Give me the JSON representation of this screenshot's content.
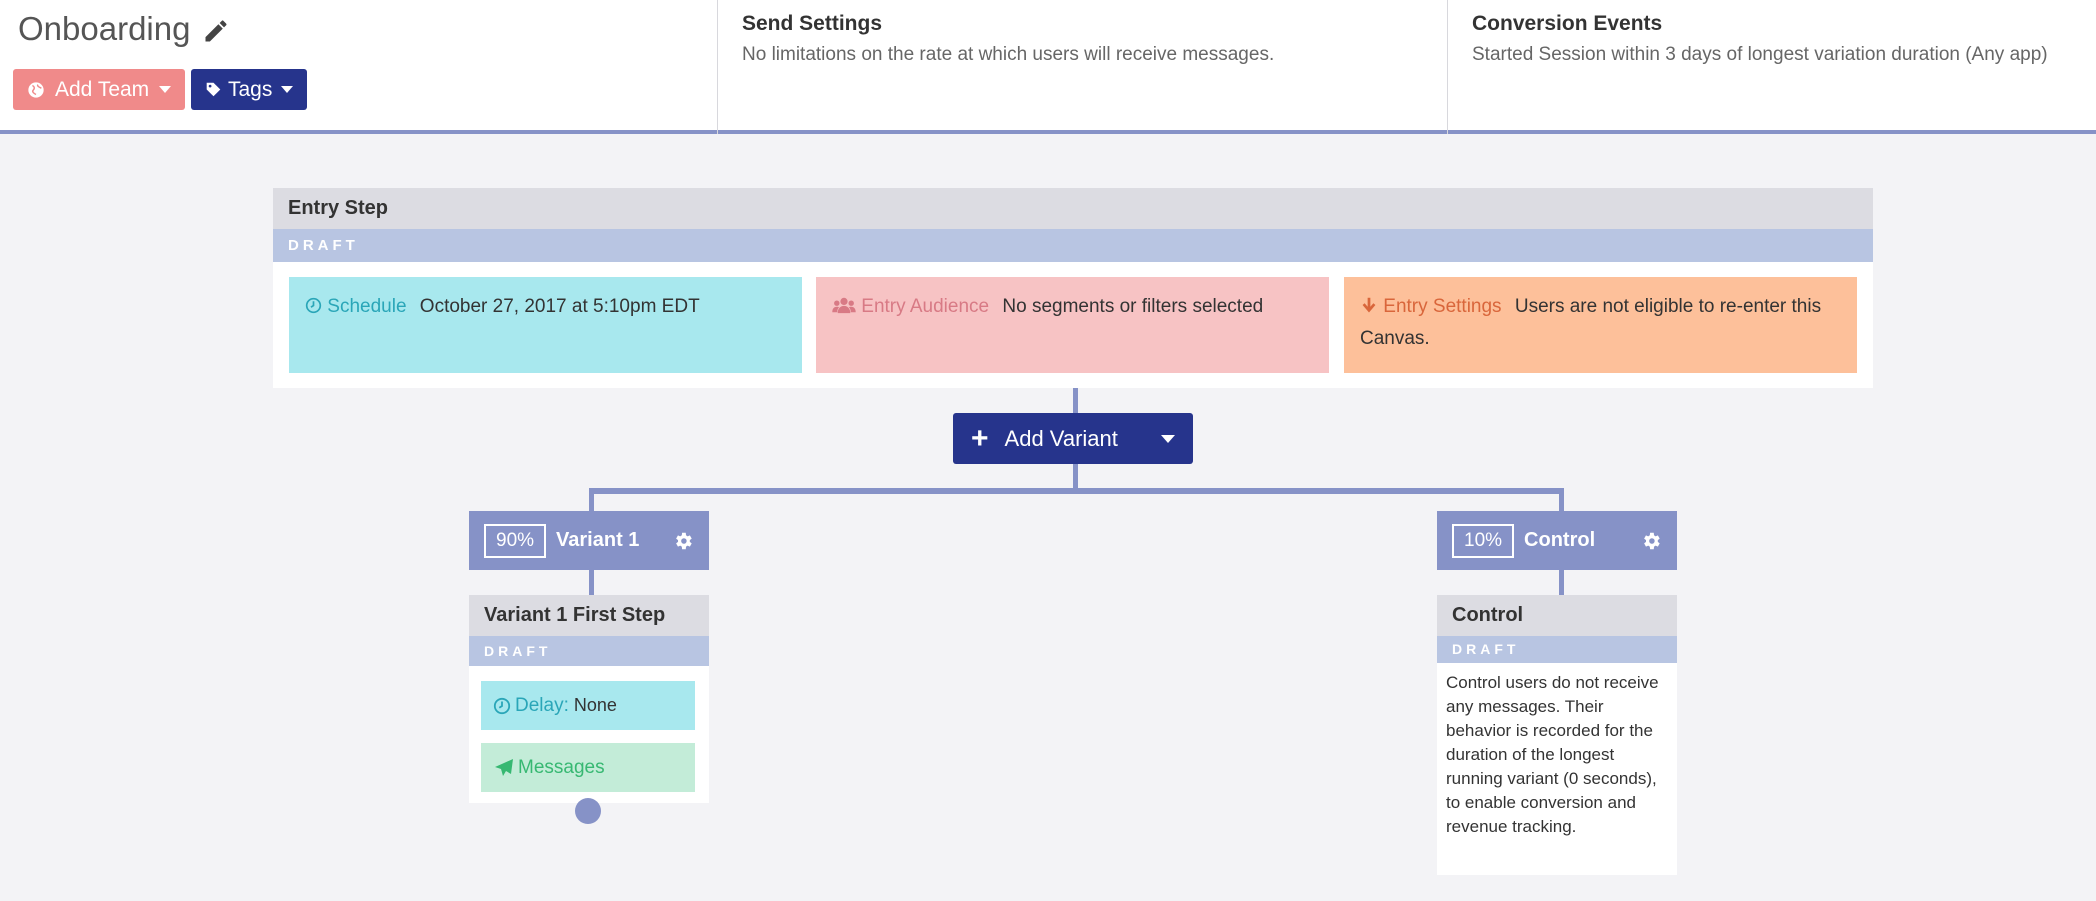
{
  "header": {
    "title": "Onboarding",
    "add_team_label": "Add Team",
    "tags_label": "Tags",
    "send_settings": {
      "heading": "Send Settings",
      "text": "No limitations on the rate at which users will receive messages."
    },
    "conversion_events": {
      "heading": "Conversion Events",
      "text": "Started Session within 3 days of longest variation duration (Any app)"
    }
  },
  "entry_step": {
    "title": "Entry Step",
    "status": "DRAFT",
    "schedule": {
      "label": "Schedule",
      "value": "October 27, 2017 at 5:10pm EDT"
    },
    "audience": {
      "label": "Entry Audience",
      "value": "No segments or filters selected"
    },
    "settings": {
      "label": "Entry Settings",
      "value": "Users are not eligible to re-enter this Canvas."
    }
  },
  "add_variant_label": "Add Variant",
  "variants": [
    {
      "percent": "90%",
      "name": "Variant 1",
      "step_title": "Variant 1 First Step",
      "status": "DRAFT",
      "delay_label": "Delay:",
      "delay_value": "None",
      "messages_label": "Messages"
    },
    {
      "percent": "10%",
      "name": "Control",
      "step_title": "Control",
      "status": "DRAFT",
      "description": "Control users do not receive any messages. Their behavior is recorded for the duration of the longest running variant (0 seconds), to enable conversion and revenue tracking."
    }
  ],
  "colors": {
    "navy": "#26348c",
    "connector": "#8692c7",
    "team_button": "#f08a8a",
    "schedule": "#a8e8ee",
    "audience": "#f7c3c4",
    "settings": "#fdc09a",
    "messages": "#c3ecd8"
  },
  "icons": [
    "pencil-icon",
    "globe-icon",
    "tag-icon",
    "clock-icon",
    "users-icon",
    "arrow-down-icon",
    "plus-icon",
    "gear-icon",
    "paper-plane-icon"
  ]
}
